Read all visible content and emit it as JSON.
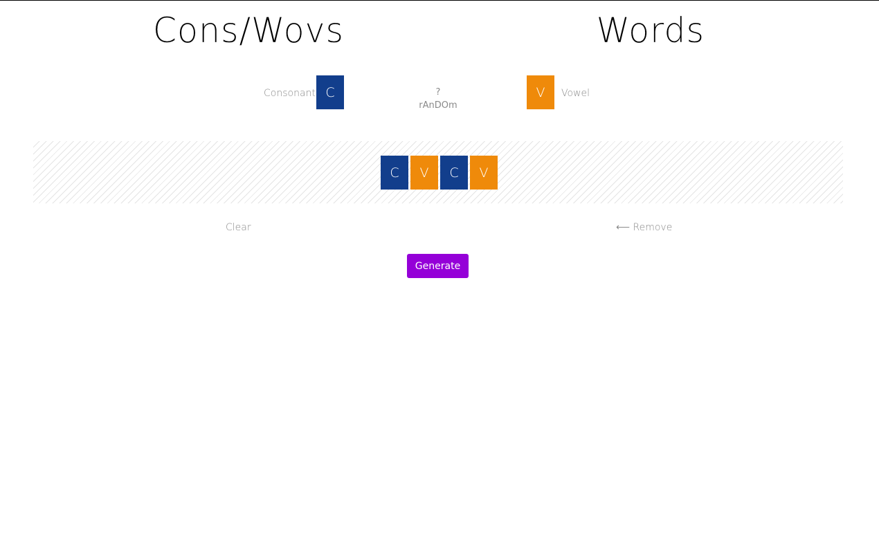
{
  "headers": {
    "left_title": "Cons/Wovs",
    "right_title": "Words"
  },
  "picker": {
    "consonant_label": "Consonant",
    "consonant_letter": "C",
    "random_symbol": "?",
    "random_label": "rAnDOm",
    "vowel_letter": "V",
    "vowel_label": "Vowel"
  },
  "pattern": {
    "tiles": [
      {
        "letter": "C",
        "kind": "consonant"
      },
      {
        "letter": "V",
        "kind": "vowel"
      },
      {
        "letter": "C",
        "kind": "consonant"
      },
      {
        "letter": "V",
        "kind": "vowel"
      }
    ]
  },
  "actions": {
    "clear_label": "Clear",
    "remove_label": "⟵ Remove",
    "generate_label": "Generate"
  },
  "colors": {
    "consonant": "#123e8c",
    "vowel": "#ef8a0a",
    "generate": "#9500d8"
  }
}
